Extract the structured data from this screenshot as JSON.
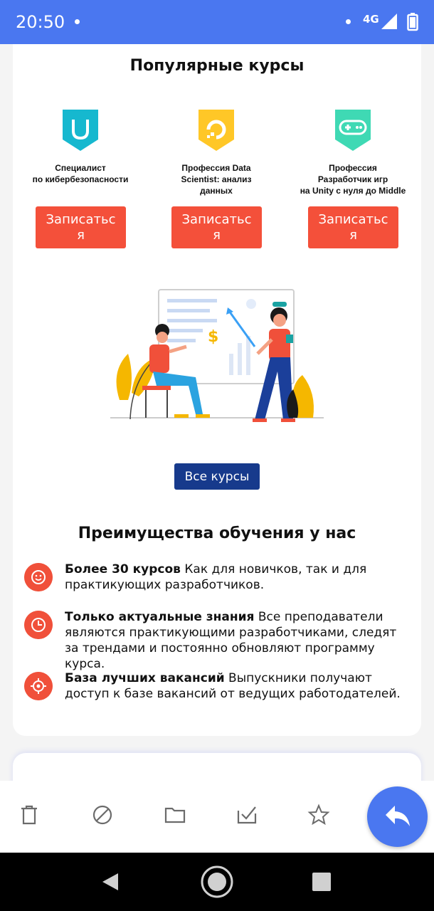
{
  "status_bar": {
    "time": "20:50",
    "network": "4G"
  },
  "courses": {
    "title": "Популярные курсы",
    "items": [
      {
        "name": "Специалист\nпо кибербезопасности",
        "button": "Записаться",
        "icon": "shield-icon",
        "color": "#16b8cf"
      },
      {
        "name": "Профессия Data\nScientist: анализ\nданных",
        "button": "Записаться",
        "icon": "data-icon",
        "color": "#ffc727"
      },
      {
        "name": "Профессия\nРазработчик игр\nна Unity с нуля до Middle",
        "button": "Записаться",
        "icon": "gamepad-icon",
        "color": "#3fd9b4"
      }
    ],
    "all_button": "Все курсы"
  },
  "advantages": {
    "title": "Преимущества обучения у нас",
    "items": [
      {
        "bold": "Более 30 курсов",
        "text": " Как для новичков, так и для практикующих разработчиков.",
        "icon": "smile-icon"
      },
      {
        "bold": "Только актуальные знания",
        "text": " Все преподаватели являются практикующими разработчиками, следят за трендами и постоянно обновляют программу курса.",
        "icon": "clock-icon"
      },
      {
        "bold": "База лучших вакансий",
        "text": " Выпускники получают доступ к базе вакансий от ведущих работодателей.",
        "icon": "target-icon"
      }
    ]
  },
  "bottom_bar": {
    "actions": [
      "trash-icon",
      "block-icon",
      "folder-icon",
      "mark-read-icon",
      "star-icon"
    ],
    "fab": "reply-icon"
  },
  "colors": {
    "status_bar": "#4a77f0",
    "enroll_button": "#f4503a",
    "all_courses_button": "#173a8c",
    "advantage_icon": "#f0503a"
  }
}
